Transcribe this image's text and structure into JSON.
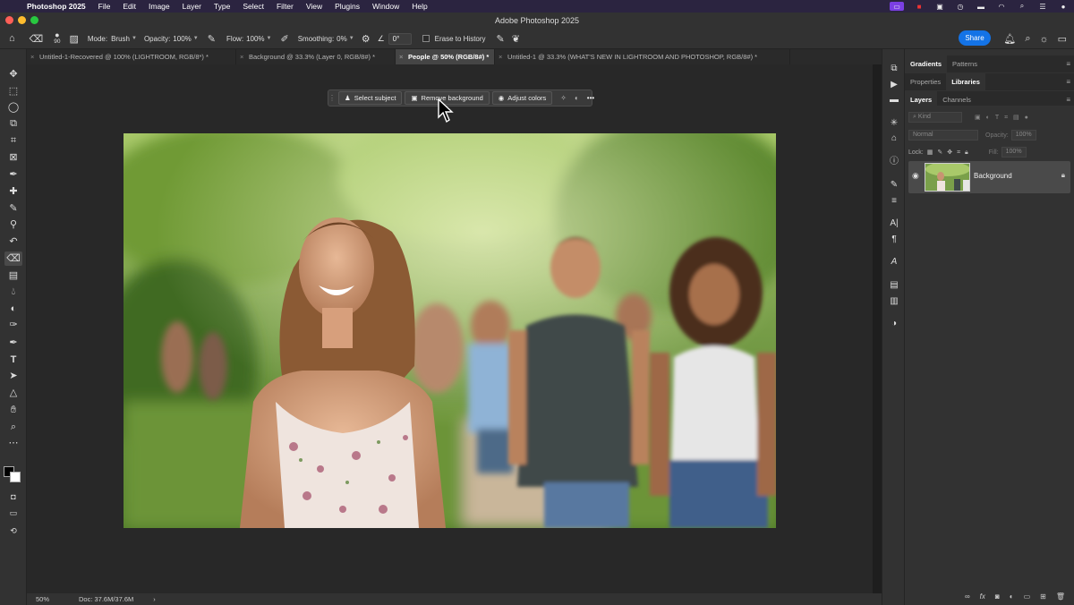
{
  "menubar": {
    "app_name": "Photoshop 2025",
    "items": [
      "File",
      "Edit",
      "Image",
      "Layer",
      "Type",
      "Select",
      "Filter",
      "View",
      "Plugins",
      "Window",
      "Help"
    ]
  },
  "window": {
    "title": "Adobe Photoshop 2025"
  },
  "options": {
    "brush_size": "90",
    "mode_label": "Mode:",
    "mode_value": "Brush",
    "opacity_label": "Opacity:",
    "opacity_value": "100%",
    "flow_label": "Flow:",
    "flow_value": "100%",
    "smoothing_label": "Smoothing:",
    "smoothing_value": "0%",
    "angle_value": "0°",
    "erase_history_label": "Erase to History",
    "share_label": "Share"
  },
  "tabs": [
    {
      "label": "Untitled-1-Recovered @ 100% (LIGHTROOM, RGB/8*) *",
      "active": false
    },
    {
      "label": "Background @ 33.3% (Layer 0, RGB/8#) *",
      "active": false
    },
    {
      "label": "People @ 50% (RGB/8#) *",
      "active": true
    },
    {
      "label": "Untitled-1 @ 33.3% (WHAT'S NEW IN LIGHTROOM AND PHOTOSHOP, RGB/8#) *",
      "active": false
    }
  ],
  "taskbar": {
    "select_subject": "Select subject",
    "remove_background": "Remove background",
    "adjust_colors": "Adjust colors"
  },
  "status": {
    "zoom": "50%",
    "doc": "Doc: 37.6M/37.6M"
  },
  "panels": {
    "group1": [
      "Gradients",
      "Patterns"
    ],
    "group2": [
      "Properties",
      "Libraries"
    ],
    "group3": [
      "Layers",
      "Channels"
    ]
  },
  "layers": {
    "kind_placeholder": "Kind",
    "blend_mode": "Normal",
    "opacity_label": "Opacity:",
    "opacity_value": "100%",
    "lock_label": "Lock:",
    "fill_label": "Fill:",
    "fill_value": "100%",
    "items": [
      {
        "name": "Background",
        "locked": true,
        "visible": true
      }
    ]
  },
  "colors": {
    "accent": "#1473e6",
    "menubar": "#2b2440"
  }
}
